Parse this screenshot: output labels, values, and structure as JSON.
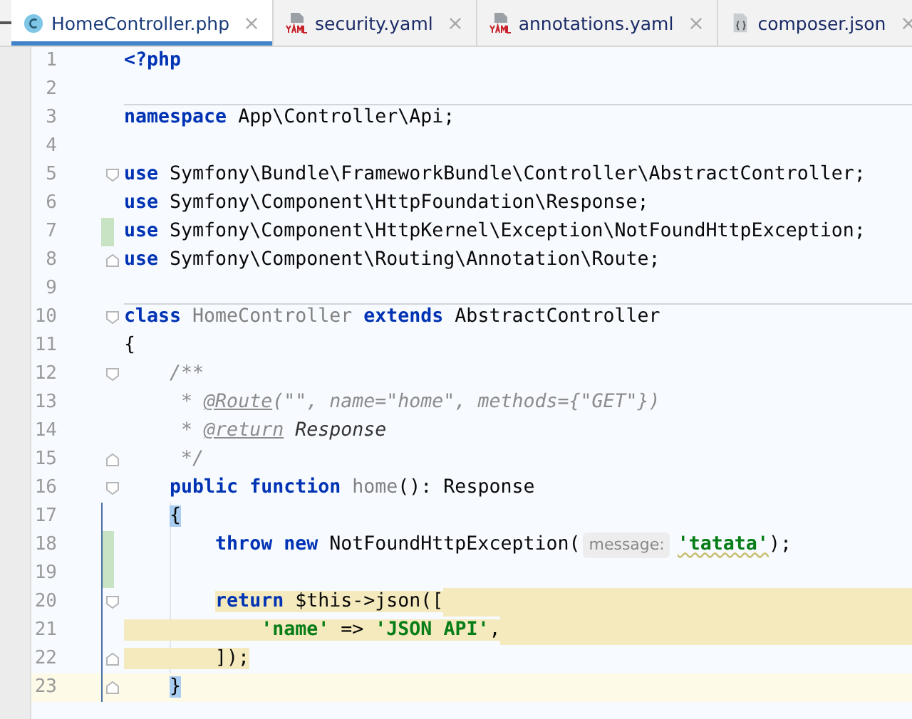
{
  "tabs": [
    {
      "label": "HomeController.php",
      "kind": "php-class",
      "selected": true
    },
    {
      "label": "security.yaml",
      "kind": "yaml",
      "selected": false
    },
    {
      "label": "annotations.yaml",
      "kind": "yaml",
      "selected": false
    },
    {
      "label": "composer.json",
      "kind": "json",
      "selected": false
    }
  ],
  "lines": [
    {
      "number": "1",
      "tokens": [
        {
          "kind": "keyword",
          "text": "<?php"
        }
      ]
    },
    {
      "number": "2"
    },
    {
      "number": "3",
      "separator_above": true,
      "tokens": [
        {
          "kind": "keyword",
          "text": "namespace"
        },
        {
          "kind": "plain",
          "text": " App\\Controller\\Api;"
        }
      ]
    },
    {
      "number": "4"
    },
    {
      "number": "5",
      "fold_start": true,
      "tokens": [
        {
          "kind": "keyword",
          "text": "use"
        },
        {
          "kind": "plain",
          "text": " Symfony\\Bundle\\FrameworkBundle\\Controller\\AbstractController;"
        }
      ]
    },
    {
      "number": "6",
      "tokens": [
        {
          "kind": "keyword",
          "text": "use"
        },
        {
          "kind": "plain",
          "text": " Symfony\\Component\\HttpFoundation\\Response;"
        }
      ]
    },
    {
      "number": "7",
      "changed": true,
      "tokens": [
        {
          "kind": "keyword",
          "text": "use"
        },
        {
          "kind": "plain",
          "text": " Symfony\\Component\\HttpKernel\\Exception\\NotFoundHttpException;"
        }
      ]
    },
    {
      "number": "8",
      "fold_end": true,
      "tokens": [
        {
          "kind": "keyword",
          "text": "use"
        },
        {
          "kind": "plain",
          "text": " Symfony\\Component\\Routing\\Annotation\\Route;"
        }
      ]
    },
    {
      "number": "9"
    },
    {
      "number": "10",
      "separator_above": true,
      "fold_start": true,
      "tokens": [
        {
          "kind": "keyword",
          "text": "class"
        },
        {
          "kind": "declaration",
          "text": " HomeController"
        },
        {
          "kind": "keyword",
          "text": " extends"
        },
        {
          "kind": "plain",
          "text": " AbstractController"
        }
      ]
    },
    {
      "number": "11",
      "tokens": [
        {
          "kind": "plain",
          "text": "{"
        }
      ]
    },
    {
      "number": "12",
      "fold_start": true,
      "tokens": [
        {
          "kind": "doc",
          "text": "    /**"
        }
      ]
    },
    {
      "number": "13",
      "tokens": [
        {
          "kind": "doc",
          "text": "     * "
        },
        {
          "kind": "doc_tag",
          "text": "@Route"
        },
        {
          "kind": "doc",
          "text": "(\"\", name=\"home\", methods={\"GET\"})"
        }
      ]
    },
    {
      "number": "14",
      "tokens": [
        {
          "kind": "doc",
          "text": "     * "
        },
        {
          "kind": "doc_tag",
          "text": "@return"
        },
        {
          "kind": "doc_type",
          "text": " Response"
        }
      ]
    },
    {
      "number": "15",
      "fold_end": true,
      "tokens": [
        {
          "kind": "doc",
          "text": "     */"
        }
      ]
    },
    {
      "number": "16",
      "fold_start": true,
      "tokens": [
        {
          "kind": "keyword",
          "text": "    public function"
        },
        {
          "kind": "declaration",
          "text": " home"
        },
        {
          "kind": "plain",
          "text": "(): Response"
        }
      ]
    },
    {
      "number": "17",
      "scope": true,
      "tokens": [
        {
          "kind": "plain",
          "text": "    {",
          "matched": true
        }
      ]
    },
    {
      "number": "18",
      "scope": true,
      "changed": true,
      "tokens": [
        {
          "kind": "keyword",
          "text": "        throw new"
        },
        {
          "kind": "plain",
          "text": " NotFoundHttpException("
        },
        {
          "kind": "hint",
          "text": "message:"
        },
        {
          "kind": "string",
          "text": "'tatata'",
          "warning": true
        },
        {
          "kind": "plain",
          "text": ");"
        }
      ]
    },
    {
      "number": "19",
      "scope": true,
      "changed": true
    },
    {
      "number": "20",
      "scope": true,
      "fold_start": true,
      "selected_to_end": true,
      "tokens": [
        {
          "kind": "keyword",
          "text": "        return",
          "selected": true
        },
        {
          "kind": "plain",
          "text": " $this->json([",
          "selected": true
        }
      ]
    },
    {
      "number": "21",
      "scope": true,
      "selected_to_end": true,
      "tokens": [
        {
          "kind": "string",
          "text": "            'name'",
          "selected": true
        },
        {
          "kind": "plain",
          "text": " => ",
          "selected": true
        },
        {
          "kind": "string",
          "text": "'JSON API'",
          "selected": true
        },
        {
          "kind": "plain",
          "text": ",",
          "selected": true
        }
      ]
    },
    {
      "number": "22",
      "scope": true,
      "fold_end": true,
      "tokens": [
        {
          "kind": "plain",
          "text": "        ]);",
          "selected": true
        }
      ]
    },
    {
      "number": "23",
      "scope": true,
      "current": true,
      "fold_end": true,
      "tokens": [
        {
          "kind": "plain",
          "text": "    }",
          "matched": true
        }
      ]
    }
  ]
}
